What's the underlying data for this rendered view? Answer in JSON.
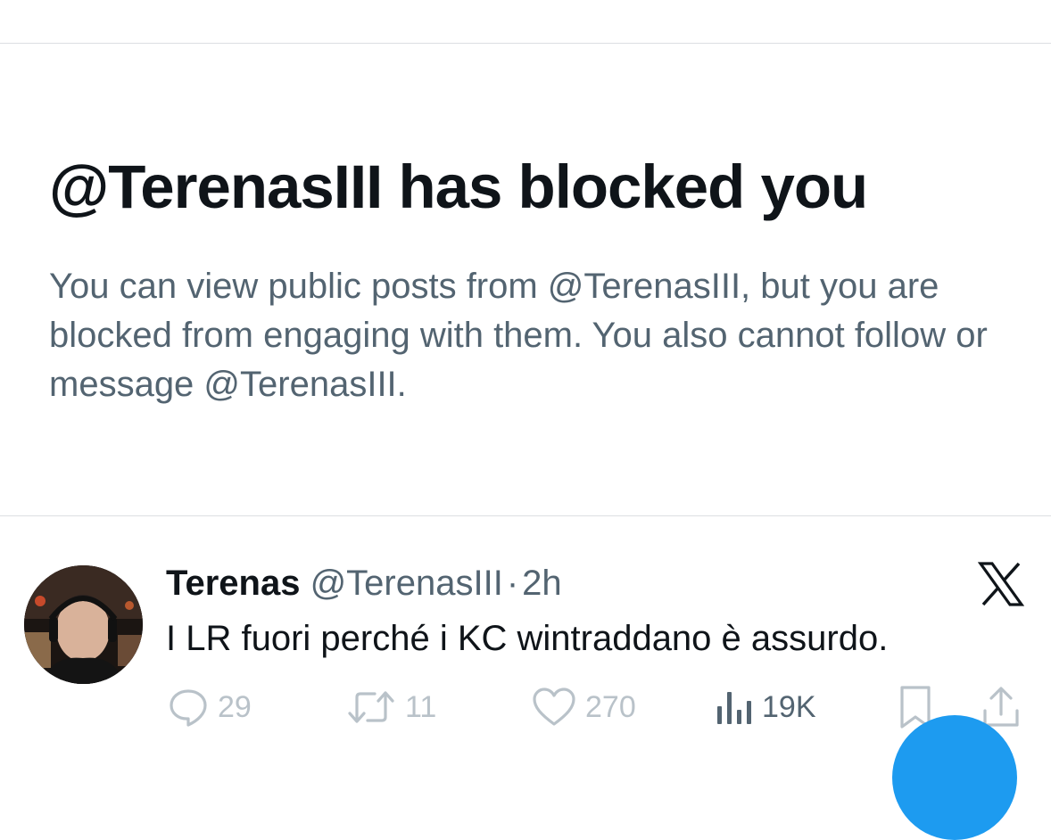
{
  "blocked": {
    "title": "@TerenasIII has blocked you",
    "description": "You can view public posts from @TerenasIII, but you are blocked from engaging with them. You also cannot follow or message @TerenasIII."
  },
  "tweet": {
    "author_name": "Terenas",
    "handle": "@TerenasIII",
    "separator": "·",
    "time": "2h",
    "text": "I LR fuori perché i KC wintraddano è assurdo.",
    "actions": {
      "replies": "29",
      "retweets": "11",
      "likes": "270",
      "views": "19K"
    }
  },
  "icons": {
    "brand": "x-logo-icon",
    "reply": "speech-bubble-icon",
    "retweet": "retweet-arrows-icon",
    "like": "heart-icon",
    "views": "bar-chart-icon",
    "bookmark": "bookmark-icon",
    "share": "share-upload-icon"
  },
  "colors": {
    "text_primary": "#0f1419",
    "text_secondary": "#536471",
    "action_muted": "#b9c2c9",
    "accent": "#1d9bf0"
  }
}
